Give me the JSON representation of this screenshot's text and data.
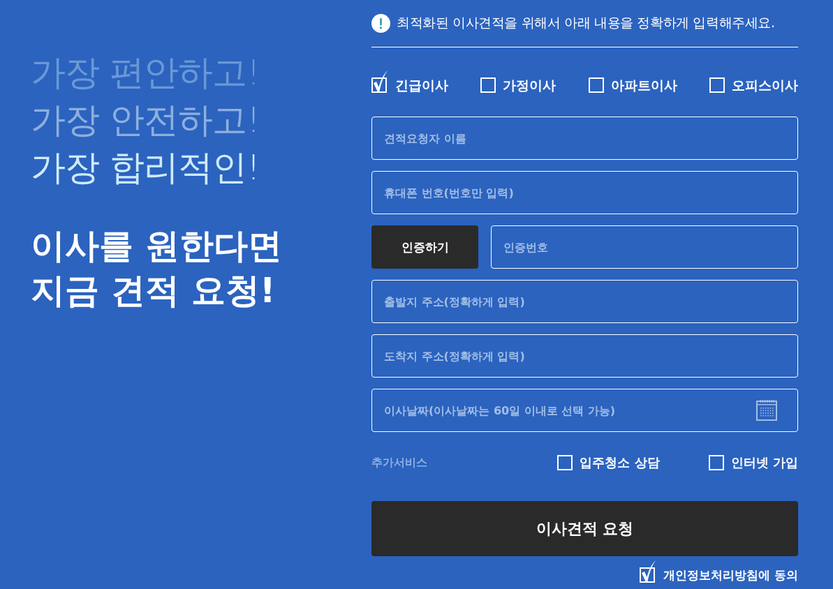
{
  "headline": {
    "lines": [
      {
        "text": "가장 편안하고!",
        "kind": "faint"
      },
      {
        "text": "가장 안전하고!",
        "kind": "soft"
      },
      {
        "text": "가장 합리적인!",
        "kind": "bright"
      }
    ],
    "call_to_action": [
      "이사를 원한다면",
      "지금 견적 요청!"
    ]
  },
  "form": {
    "notice": "최적화된 이사견적을 위해서 아래 내용을 정확하게 입력해주세요.",
    "move_types": [
      {
        "label": "긴급이사",
        "checked": true
      },
      {
        "label": "가정이사",
        "checked": false
      },
      {
        "label": "아파트이사",
        "checked": false
      },
      {
        "label": "오피스이사",
        "checked": false
      }
    ],
    "fields": [
      {
        "kind": "text",
        "placeholder": "견적요청자 이름"
      },
      {
        "kind": "text",
        "placeholder": "휴대폰 번호(번호만 입력)"
      },
      {
        "kind": "verify",
        "button": "인증하기",
        "placeholder": "인증번호"
      },
      {
        "kind": "text",
        "placeholder": "출발지 주소(정확하게 입력)"
      },
      {
        "kind": "text",
        "placeholder": "도착지 주소(정확하게 입력)"
      },
      {
        "kind": "date",
        "placeholder": "이사날짜(이사날짜는 60일 이내로 선택 가능)"
      }
    ],
    "extra_services": {
      "label": "추가서비스",
      "options": [
        {
          "label": "입주청소 상담",
          "checked": false
        },
        {
          "label": "인터넷 가입",
          "checked": false
        }
      ]
    },
    "submit": "이사견적 요청",
    "agreement": {
      "label": "개인정보처리방침에 동의",
      "checked": true
    }
  }
}
